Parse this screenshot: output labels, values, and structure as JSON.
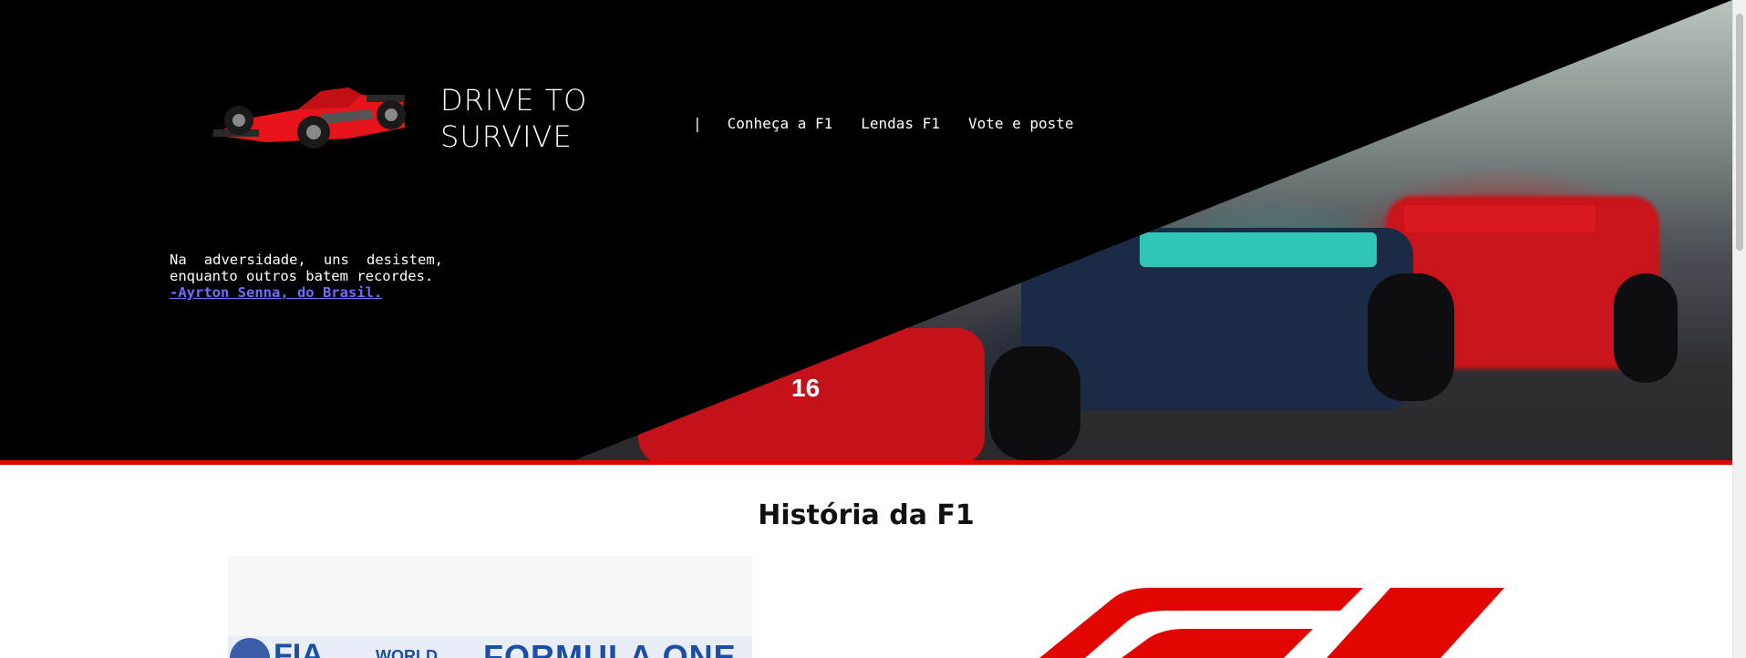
{
  "header": {
    "brand_line1": "DRIVE TO",
    "brand_line2": "SURVIVE",
    "nav_separator": "|",
    "nav_items": [
      {
        "label": "Conheça a F1"
      },
      {
        "label": "Lendas F1"
      },
      {
        "label": "Vote e poste"
      }
    ]
  },
  "hero": {
    "quote_line": "Na adversidade, uns desistem, enquanto outros batem recordes.",
    "quote_author": "-Ayrton Senna, do Brasil.",
    "car_number": "16"
  },
  "main": {
    "section_title": "História da F1",
    "poster": {
      "fia": "FIA",
      "world": "WORLD",
      "formula_one": "FORMULA ONE"
    }
  },
  "colors": {
    "accent_red": "#e10600",
    "link_blue": "#6f6cff",
    "hero_background": "#000000"
  }
}
